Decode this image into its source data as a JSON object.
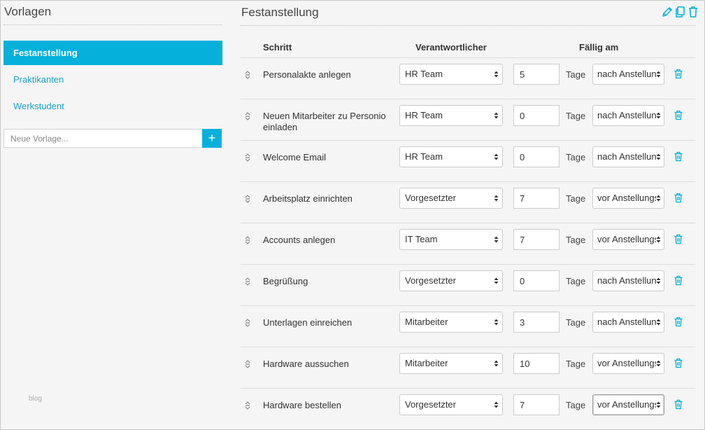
{
  "sidebar": {
    "title": "Vorlagen",
    "templates": [
      {
        "label": "Festanstellung",
        "active": true
      },
      {
        "label": "Praktikanten",
        "active": false
      },
      {
        "label": "Werkstudent",
        "active": false
      }
    ],
    "new_template_placeholder": "Neue Vorlage...",
    "add_label": "+",
    "footer_link": "blog"
  },
  "main": {
    "title": "Festanstellung",
    "toolbar_icons": [
      "pencil-icon",
      "copy-icon",
      "trash-icon"
    ],
    "columns": {
      "step": "Schritt",
      "responsible": "Verantwortlicher",
      "due": "Fällig am"
    },
    "unit_label": "Tage",
    "rows": [
      {
        "step": "Personalakte anlegen",
        "responsible": "HR Team",
        "days": "5",
        "timing": "nach Anstellung"
      },
      {
        "step": "Neuen Mitarbeiter zu Personio einladen",
        "responsible": "HR Team",
        "days": "0",
        "timing": "nach Anstellung"
      },
      {
        "step": "Welcome Email",
        "responsible": "HR Team",
        "days": "0",
        "timing": "nach Anstellung"
      },
      {
        "step": "Arbeitsplatz einrichten",
        "responsible": "Vorgesetzter",
        "days": "7",
        "timing": "vor Anstellungsbeginn"
      },
      {
        "step": "Accounts anlegen",
        "responsible": "IT Team",
        "days": "7",
        "timing": "vor Anstellungsbeginn"
      },
      {
        "step": "Begrüßung",
        "responsible": "Vorgesetzter",
        "days": "0",
        "timing": "nach Anstellung"
      },
      {
        "step": "Unterlagen einreichen",
        "responsible": "Mitarbeiter",
        "days": "3",
        "timing": "nach Anstellung"
      },
      {
        "step": "Hardware aussuchen",
        "responsible": "Mitarbeiter",
        "days": "10",
        "timing": "vor Anstellungsbeginn"
      },
      {
        "step": "Hardware bestellen",
        "responsible": "Vorgesetzter",
        "days": "7",
        "timing": "vor Anstellungsbeginn"
      }
    ]
  },
  "colors": {
    "accent": "#05b0db",
    "link": "#1aa0c8",
    "background": "#f5f5f5"
  }
}
